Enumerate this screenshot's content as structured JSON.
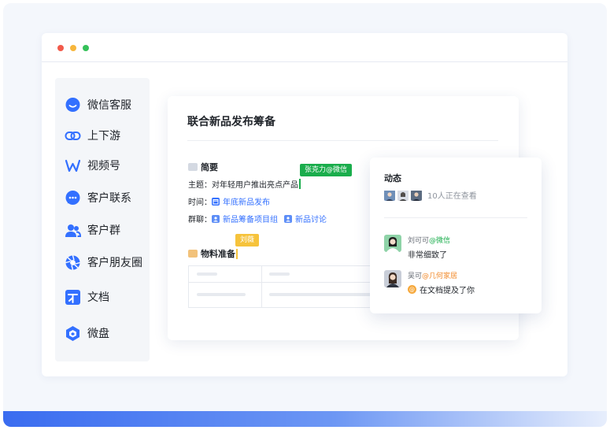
{
  "sidebar": {
    "items": [
      {
        "label": "微信客服",
        "icon": "wechat-service-icon"
      },
      {
        "label": "上下游",
        "icon": "link-chain-icon"
      },
      {
        "label": "视频号",
        "icon": "channels-icon"
      },
      {
        "label": "客户联系",
        "icon": "chat-bubble-icon"
      },
      {
        "label": "客户群",
        "icon": "group-icon"
      },
      {
        "label": "客户朋友圈",
        "icon": "moments-icon"
      },
      {
        "label": "文档",
        "icon": "document-icon"
      },
      {
        "label": "微盘",
        "icon": "drive-icon"
      }
    ]
  },
  "doc": {
    "title": "联合新品发布筹备",
    "summary_heading": "简要",
    "topic_key": "主题：",
    "topic_value": "对年轻用户推出亮点产品",
    "time_key": "时间：",
    "time_link": "年底新品发布",
    "group_key": "群聊：",
    "group_link_1": "新品筹备项目组",
    "group_link_2": "新品讨论",
    "materials_heading": "物料准备",
    "tag_editor_1": "张克力@微信",
    "tag_editor_2": "刘薇"
  },
  "activity": {
    "title": "动态",
    "viewers_text": "10人正在查看",
    "comments": [
      {
        "name": "刘可可",
        "corp": "@微信",
        "text": "非常细致了"
      },
      {
        "name": "吴可",
        "corp": "@几何家居",
        "text": "在文档提及了你"
      }
    ]
  },
  "colors": {
    "accent": "#3370ff",
    "wechat_green": "#1aad4c",
    "tag_yellow": "#f6c33b",
    "bar_blue": "#3a6cf0"
  }
}
